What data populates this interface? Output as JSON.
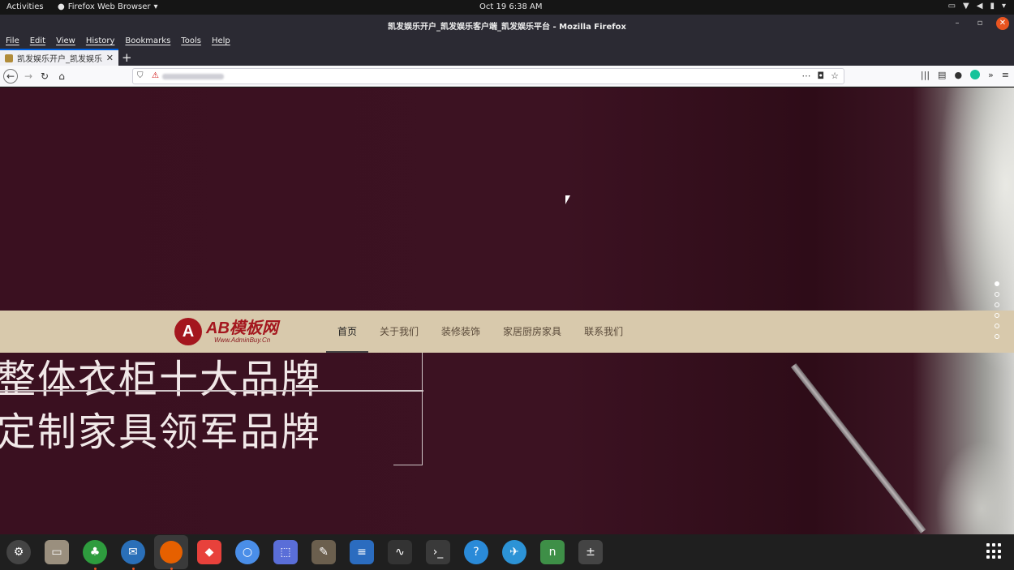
{
  "system": {
    "activities_label": "Activities",
    "app_menu_label": "Firefox Web Browser",
    "clock": "Oct 19   6:38 AM"
  },
  "window": {
    "title": "凯发娱乐开户_凯发娱乐客户端_凯发娱乐平台 - Mozilla Firefox"
  },
  "menubar": {
    "items": [
      "File",
      "Edit",
      "View",
      "History",
      "Bookmarks",
      "Tools",
      "Help"
    ]
  },
  "tabs": [
    {
      "label": "凯发娱乐开户_凯发娱乐客户"
    }
  ],
  "hero": {
    "slogan_line1": "整体衣柜十大品牌",
    "slogan_line2": "定制家具领军品牌"
  },
  "site": {
    "logo_big": "AB模板网",
    "logo_small": "Www.AdminBuy.Cn",
    "nav": [
      "首页",
      "关于我们",
      "装修装饰",
      "家居厨房家具",
      "联系我们"
    ]
  },
  "slides": {
    "count": 6,
    "active_index": 0
  },
  "dock": {
    "apps": [
      "settings-icon",
      "files-icon",
      "inkscape-icon",
      "thunderbird-icon",
      "firefox-icon",
      "anydesk-icon",
      "chromium-icon",
      "screenshot-icon",
      "gimp-icon",
      "writer-icon",
      "system-monitor-icon",
      "terminal-icon",
      "help-icon",
      "remmina-icon",
      "notepadqq-icon",
      "calculator-icon"
    ]
  }
}
